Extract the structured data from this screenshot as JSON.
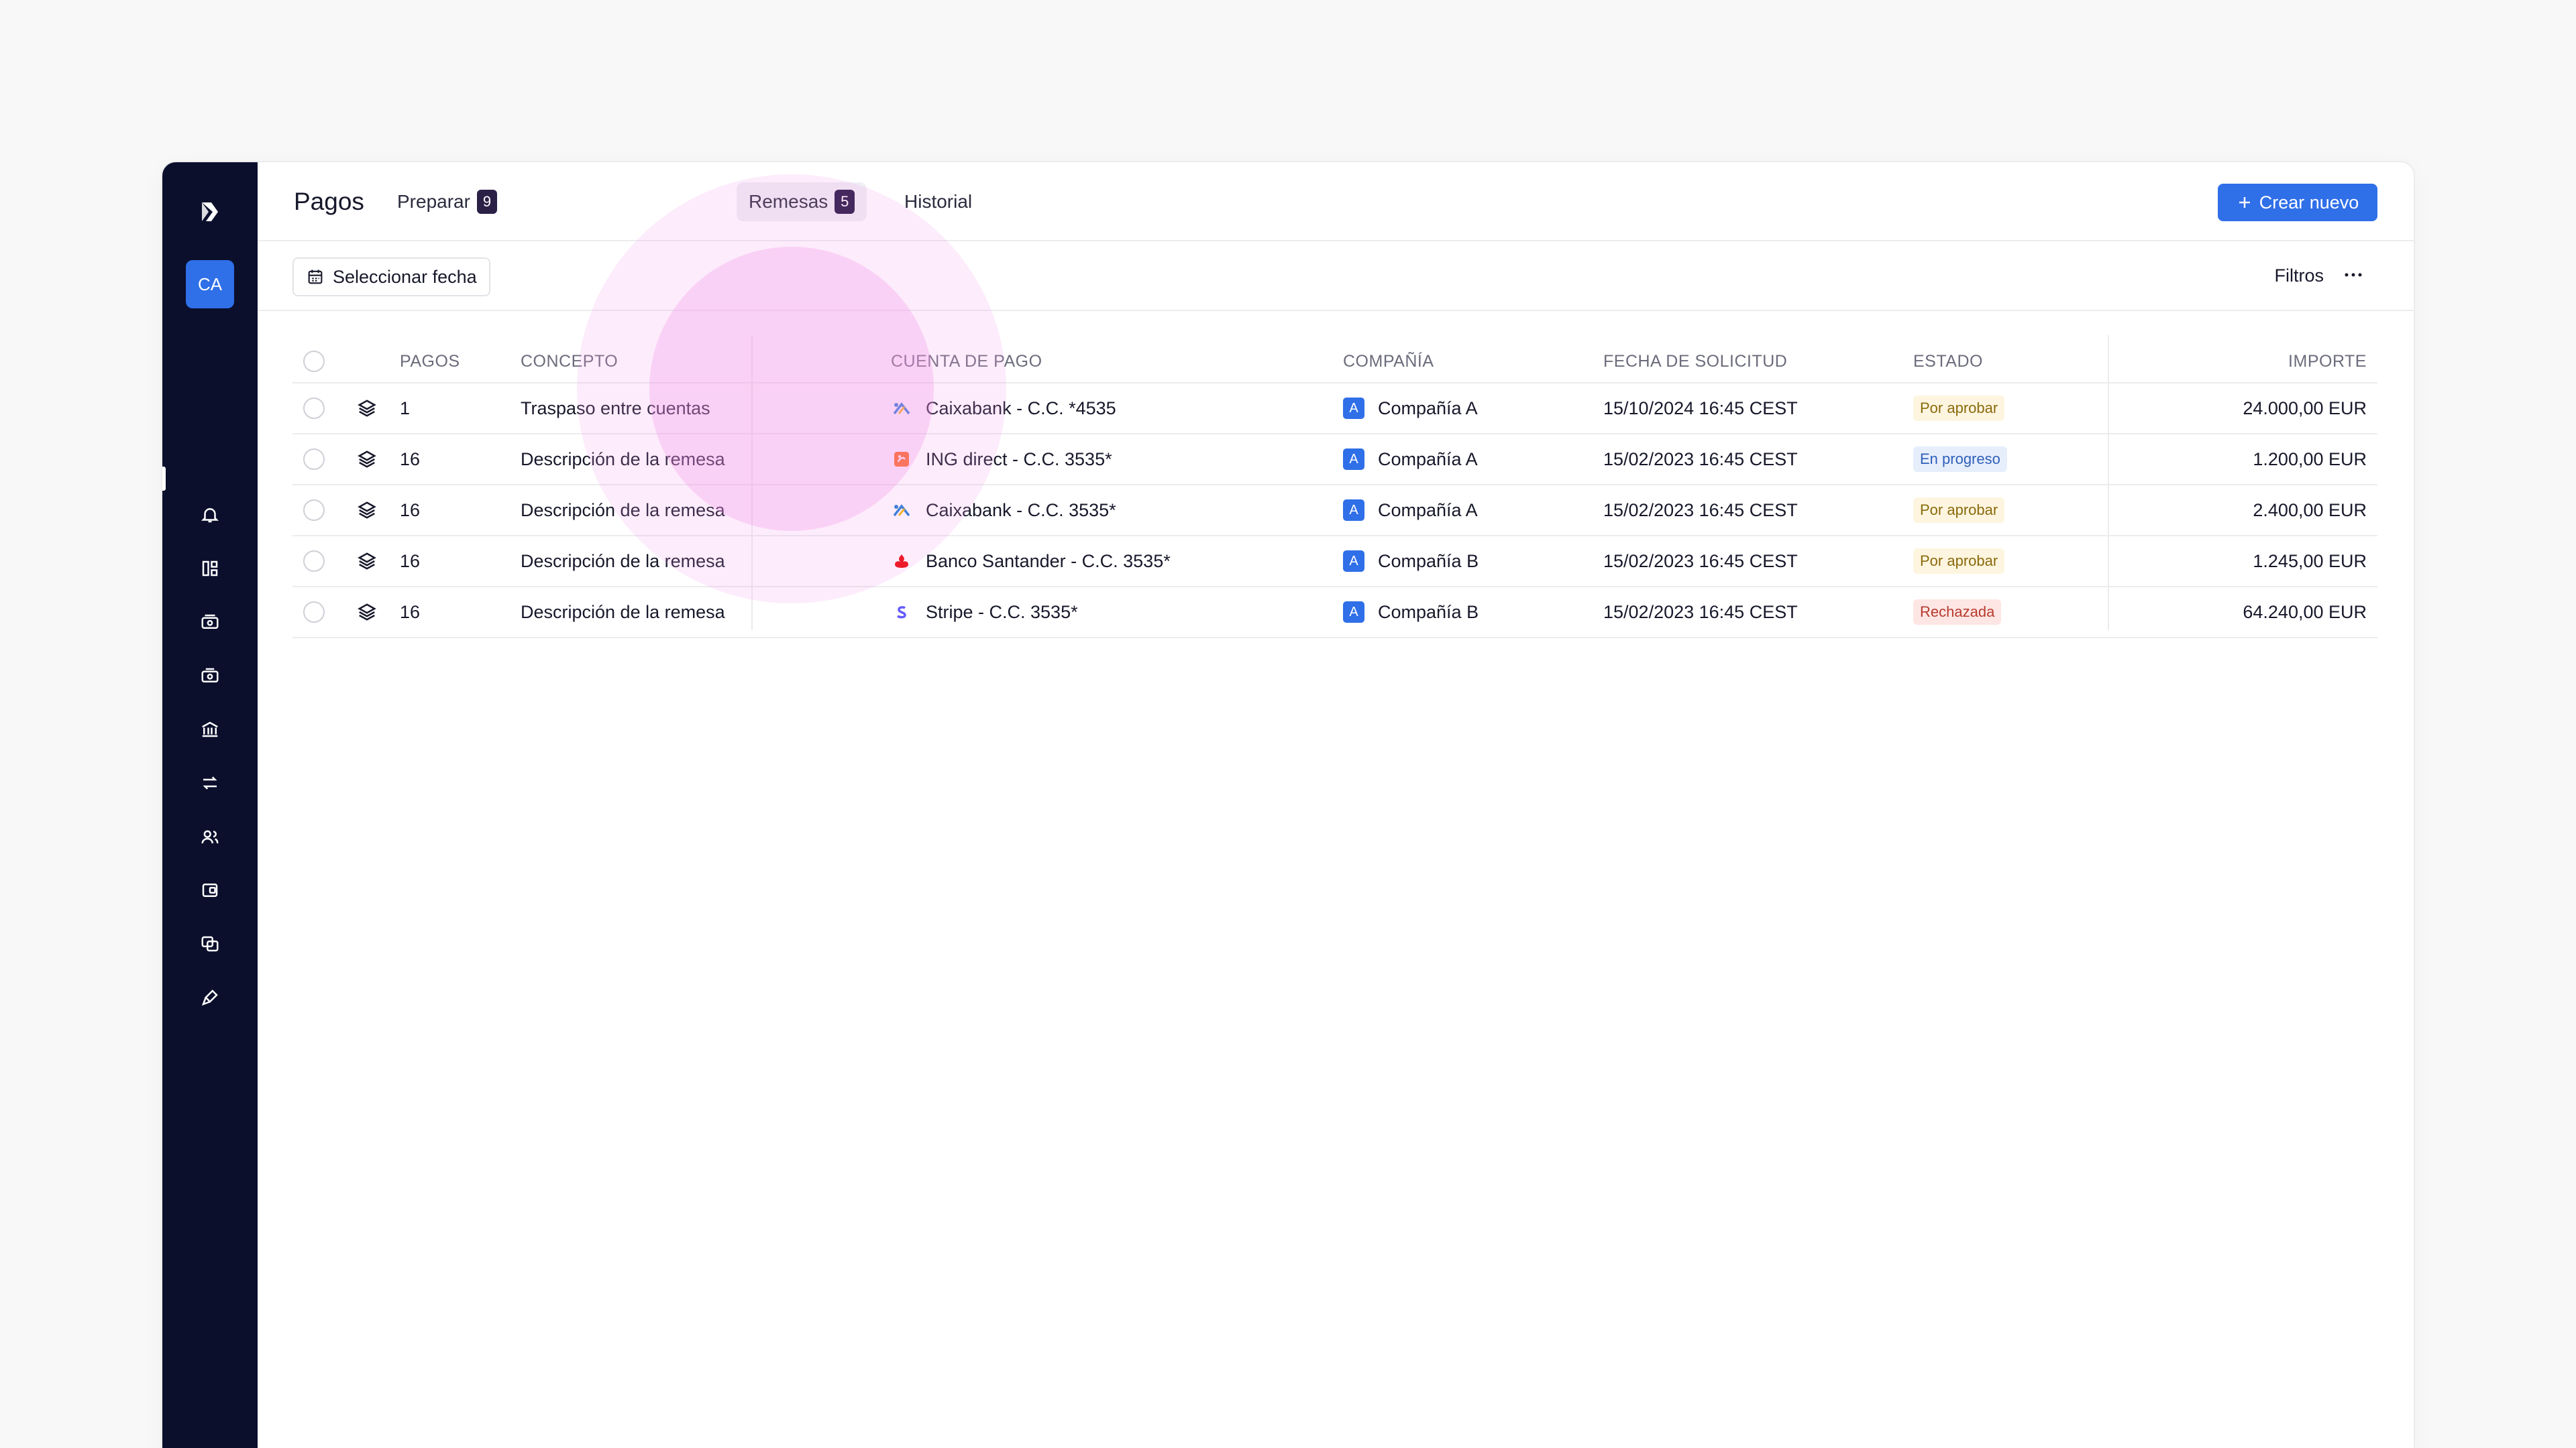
{
  "colors": {
    "sidebar": "#0b0f2c",
    "accent": "#2f6fe8",
    "highlight": "#f68ce8"
  },
  "sidebar": {
    "avatar": "CA",
    "items": [
      {
        "icon": "bell-icon"
      },
      {
        "icon": "dashboard-icon"
      },
      {
        "icon": "payments-icon",
        "active": true
      },
      {
        "icon": "collections-icon"
      },
      {
        "icon": "bank-icon"
      },
      {
        "icon": "transfer-icon"
      },
      {
        "icon": "users-icon"
      },
      {
        "icon": "wallet-icon"
      },
      {
        "icon": "documents-icon"
      },
      {
        "icon": "integrations-icon"
      }
    ]
  },
  "header": {
    "title": "Pagos",
    "tabs": [
      {
        "label": "Preparar",
        "count": "9"
      },
      {
        "label": "Remesas",
        "count": "5"
      },
      {
        "label": "Historial"
      }
    ],
    "create_label": "Crear nuevo"
  },
  "toolbar": {
    "date_label": "Seleccionar fecha",
    "filters_label": "Filtros"
  },
  "table": {
    "columns": [
      "PAGOS",
      "CONCEPTO",
      "CUENTA DE PAGO",
      "COMPAÑÍA",
      "FECHA DE SOLICITUD",
      "ESTADO",
      "IMPORTE"
    ],
    "rows": [
      {
        "pagos": "1",
        "concepto": "Traspaso entre cuentas",
        "bank": "caixabank",
        "cuenta": "Caixabank - C.C. *4535",
        "company_initial": "A",
        "company": "Compañía A",
        "fecha": "15/10/2024 16:45 CEST",
        "estado": "Por aprobar",
        "importe": "24.000,00 EUR"
      },
      {
        "pagos": "16",
        "concepto": "Descripción de la remesa",
        "bank": "ing",
        "cuenta": "ING direct - C.C. 3535*",
        "company_initial": "A",
        "company": "Compañía A",
        "fecha": "15/02/2023 16:45 CEST",
        "estado": "En progreso",
        "importe": "1.200,00 EUR"
      },
      {
        "pagos": "16",
        "concepto": "Descripción de la remesa",
        "bank": "caixabank",
        "cuenta": "Caixabank - C.C. 3535*",
        "company_initial": "A",
        "company": "Compañía A",
        "fecha": "15/02/2023 16:45 CEST",
        "estado": "Por aprobar",
        "importe": "2.400,00 EUR"
      },
      {
        "pagos": "16",
        "concepto": "Descripción de la remesa",
        "bank": "santander",
        "cuenta": "Banco Santander - C.C. 3535*",
        "company_initial": "A",
        "company": "Compañía B",
        "fecha": "15/02/2023 16:45 CEST",
        "estado": "Por aprobar",
        "importe": "1.245,00 EUR"
      },
      {
        "pagos": "16",
        "concepto": "Descripción de la remesa",
        "bank": "stripe",
        "cuenta": "Stripe - C.C. 3535*",
        "company_initial": "A",
        "company": "Compañía B",
        "fecha": "15/02/2023 16:45 CEST",
        "estado": "Rechazada",
        "importe": "64.240,00 EUR"
      }
    ]
  }
}
